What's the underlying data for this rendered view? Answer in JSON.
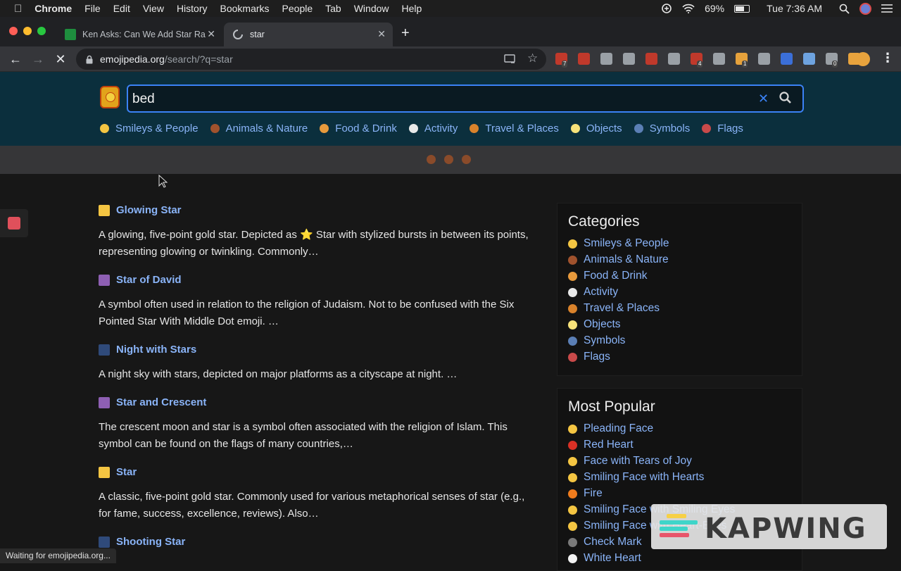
{
  "menubar": {
    "apple": "",
    "app": "Chrome",
    "items": [
      "File",
      "Edit",
      "View",
      "History",
      "Bookmarks",
      "People",
      "Tab",
      "Window",
      "Help"
    ],
    "battery": "69%",
    "battery_level": 0.69,
    "clock": "Tue 7:36 AM"
  },
  "tabs": [
    {
      "title": "Ken Asks: Can We Add Star Ra",
      "favicon_color": "#1e8e3e"
    },
    {
      "title": "star",
      "loading": true
    }
  ],
  "toolbar": {
    "url_host": "emojipedia.org",
    "url_path": "/search/?q=star",
    "extensions": [
      {
        "color": "#c0392b",
        "badge": "7"
      },
      {
        "color": "#c0392b",
        "badge": ""
      },
      {
        "color": "#9aa0a6",
        "badge": ""
      },
      {
        "color": "#9aa0a6",
        "badge": ""
      },
      {
        "color": "#c0392b",
        "badge": ""
      },
      {
        "color": "#9aa0a6",
        "badge": ""
      },
      {
        "color": "#c0392b",
        "badge": "4"
      },
      {
        "color": "#9aa0a6",
        "badge": ""
      },
      {
        "color": "#e6a23c",
        "badge": "1"
      },
      {
        "color": "#9aa0a6",
        "badge": ""
      },
      {
        "color": "#3b6fd8",
        "badge": ""
      },
      {
        "color": "#6ea3e0",
        "badge": ""
      },
      {
        "color": "#9aa0a6",
        "badge": "0"
      },
      {
        "color": "#e8a33d",
        "badge": ""
      }
    ]
  },
  "search": {
    "value": "bed"
  },
  "categories_nav": [
    {
      "label": "Smileys & People",
      "color": "#f4c542"
    },
    {
      "label": "Animals & Nature",
      "color": "#a0522d"
    },
    {
      "label": "Food & Drink",
      "color": "#e89a3c"
    },
    {
      "label": "Activity",
      "color": "#e8e8e8"
    },
    {
      "label": "Travel & Places",
      "color": "#d9822b"
    },
    {
      "label": "Objects",
      "color": "#f7e27a"
    },
    {
      "label": "Symbols",
      "color": "#5b7fb5"
    },
    {
      "label": "Flags",
      "color": "#c94a4a"
    }
  ],
  "results": [
    {
      "title": "Glowing Star",
      "icon_color": "#f4c542",
      "desc": "A glowing, five-point gold star. Depicted as ⭐ Star with stylized bursts in between its points, representing glowing or twinkling. Commonly…"
    },
    {
      "title": "Star of David",
      "icon_color": "#8e5fb3",
      "desc": "A symbol often used in relation to the religion of Judaism. Not to be confused with the Six Pointed Star With Middle Dot emoji. …"
    },
    {
      "title": "Night with Stars",
      "icon_color": "#2f4a7a",
      "desc": "A night sky with stars, depicted on major platforms as a cityscape at night. …"
    },
    {
      "title": "Star and Crescent",
      "icon_color": "#8e5fb3",
      "desc": "The crescent moon and star is a symbol often associated with the religion of Islam. This symbol can be found on the flags of many countries,…"
    },
    {
      "title": "Star",
      "icon_color": "#f4c542",
      "desc": "A classic, five-point gold star. Commonly used for various metaphorical senses of star (e.g., for fame, success, excellence, reviews). Also…"
    },
    {
      "title": "Shooting Star",
      "icon_color": "#2f4a7a",
      "desc": ""
    }
  ],
  "sidebar": {
    "categories_title": "Categories",
    "categories": [
      {
        "label": "Smileys & People",
        "color": "#f4c542"
      },
      {
        "label": "Animals & Nature",
        "color": "#a0522d"
      },
      {
        "label": "Food & Drink",
        "color": "#e89a3c"
      },
      {
        "label": "Activity",
        "color": "#e8e8e8"
      },
      {
        "label": "Travel & Places",
        "color": "#d9822b"
      },
      {
        "label": "Objects",
        "color": "#f7e27a"
      },
      {
        "label": "Symbols",
        "color": "#5b7fb5"
      },
      {
        "label": "Flags",
        "color": "#c94a4a"
      }
    ],
    "popular_title": "Most Popular",
    "popular": [
      {
        "label": "Pleading Face",
        "color": "#f4c542"
      },
      {
        "label": "Red Heart",
        "color": "#d93025"
      },
      {
        "label": "Face with Tears of Joy",
        "color": "#f4c542"
      },
      {
        "label": "Smiling Face with Hearts",
        "color": "#f4c542"
      },
      {
        "label": "Fire",
        "color": "#f07c1d"
      },
      {
        "label": "Smiling Face with Smiling Eyes",
        "color": "#f4c542"
      },
      {
        "label": "Smiling Face with Heart-Eyes",
        "color": "#f4c542"
      },
      {
        "label": "Check Mark",
        "color": "#7a7a7a"
      },
      {
        "label": "White Heart",
        "color": "#f2f2f2"
      }
    ]
  },
  "status": "Waiting for emojipedia.org...",
  "watermark": "KAPWING"
}
